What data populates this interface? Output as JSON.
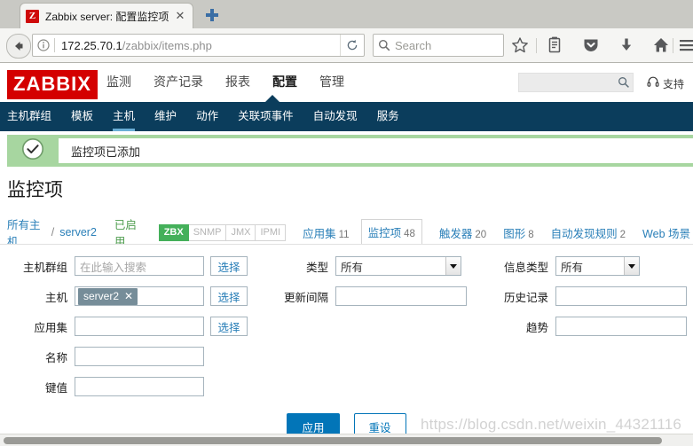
{
  "browser": {
    "tab": {
      "favicon_letter": "Z",
      "title": "Zabbix server: 配置监控项",
      "close_label": "✕"
    },
    "newtab_name": "new-tab-button",
    "url": {
      "host": "172.25.70.1",
      "path": "/zabbix/items.php"
    },
    "search_placeholder": "Search",
    "toolbar_icons": [
      "bookmark-star-icon",
      "reader-list-icon",
      "pocket-icon",
      "downloads-icon",
      "home-icon",
      "menu-icon"
    ]
  },
  "header": {
    "logo": "ZABBIX",
    "nav": [
      {
        "label": "监测",
        "active": false
      },
      {
        "label": "资产记录",
        "active": false
      },
      {
        "label": "报表",
        "active": false
      },
      {
        "label": "配置",
        "active": true
      },
      {
        "label": "管理",
        "active": false
      }
    ],
    "search_value": "",
    "support_label": "支持"
  },
  "subnav": [
    {
      "label": "主机群组",
      "active": false
    },
    {
      "label": "模板",
      "active": false
    },
    {
      "label": "主机",
      "active": true
    },
    {
      "label": "维护",
      "active": false
    },
    {
      "label": "动作",
      "active": false
    },
    {
      "label": "关联项事件",
      "active": false
    },
    {
      "label": "自动发现",
      "active": false
    },
    {
      "label": "服务",
      "active": false
    }
  ],
  "message": {
    "text": "监控项已添加",
    "icon": "check-circle-icon",
    "color": "#a7d6a0"
  },
  "page": {
    "title": "监控项"
  },
  "breadcrumb": {
    "all_hosts": "所有主机",
    "separator": "/",
    "host": "server2",
    "status": "已启用",
    "interfaces": [
      {
        "label": "ZBX",
        "enabled": true
      },
      {
        "label": "SNMP",
        "enabled": false
      },
      {
        "label": "JMX",
        "enabled": false
      },
      {
        "label": "IPMI",
        "enabled": false
      }
    ],
    "tabs": [
      {
        "label": "应用集",
        "count": "11",
        "selected": false
      },
      {
        "label": "监控项",
        "count": "48",
        "selected": true
      },
      {
        "label": "触发器",
        "count": "20",
        "selected": false
      },
      {
        "label": "图形",
        "count": "8",
        "selected": false
      },
      {
        "label": "自动发现规则",
        "count": "2",
        "selected": false
      },
      {
        "label": "Web 场景",
        "count": "",
        "selected": false
      }
    ]
  },
  "filter": {
    "host_group": {
      "label": "主机群组",
      "placeholder": "在此输入搜索",
      "value": ""
    },
    "host": {
      "label": "主机",
      "chip": "server2",
      "chip_remove": "✕"
    },
    "app_set": {
      "label": "应用集",
      "value": ""
    },
    "name": {
      "label": "名称",
      "value": ""
    },
    "key": {
      "label": "键值",
      "value": ""
    },
    "select_button": "选择",
    "type": {
      "label": "类型",
      "value": "所有"
    },
    "update_interval": {
      "label": "更新间隔",
      "value": ""
    },
    "info_type": {
      "label": "信息类型",
      "value": "所有"
    },
    "history": {
      "label": "历史记录",
      "value": ""
    },
    "trends": {
      "label": "趋势",
      "value": ""
    }
  },
  "actions": {
    "apply": "应用",
    "reset": "重设"
  },
  "watermark": "https://blog.csdn.net/weixin_44321116",
  "colors": {
    "brand_red": "#d40000",
    "nav_dark": "#0b3d5c",
    "accent_blue": "#0275b8",
    "link_blue": "#2a7fb8",
    "success_green": "#44b05a",
    "banner_green": "#a7d6a0"
  }
}
